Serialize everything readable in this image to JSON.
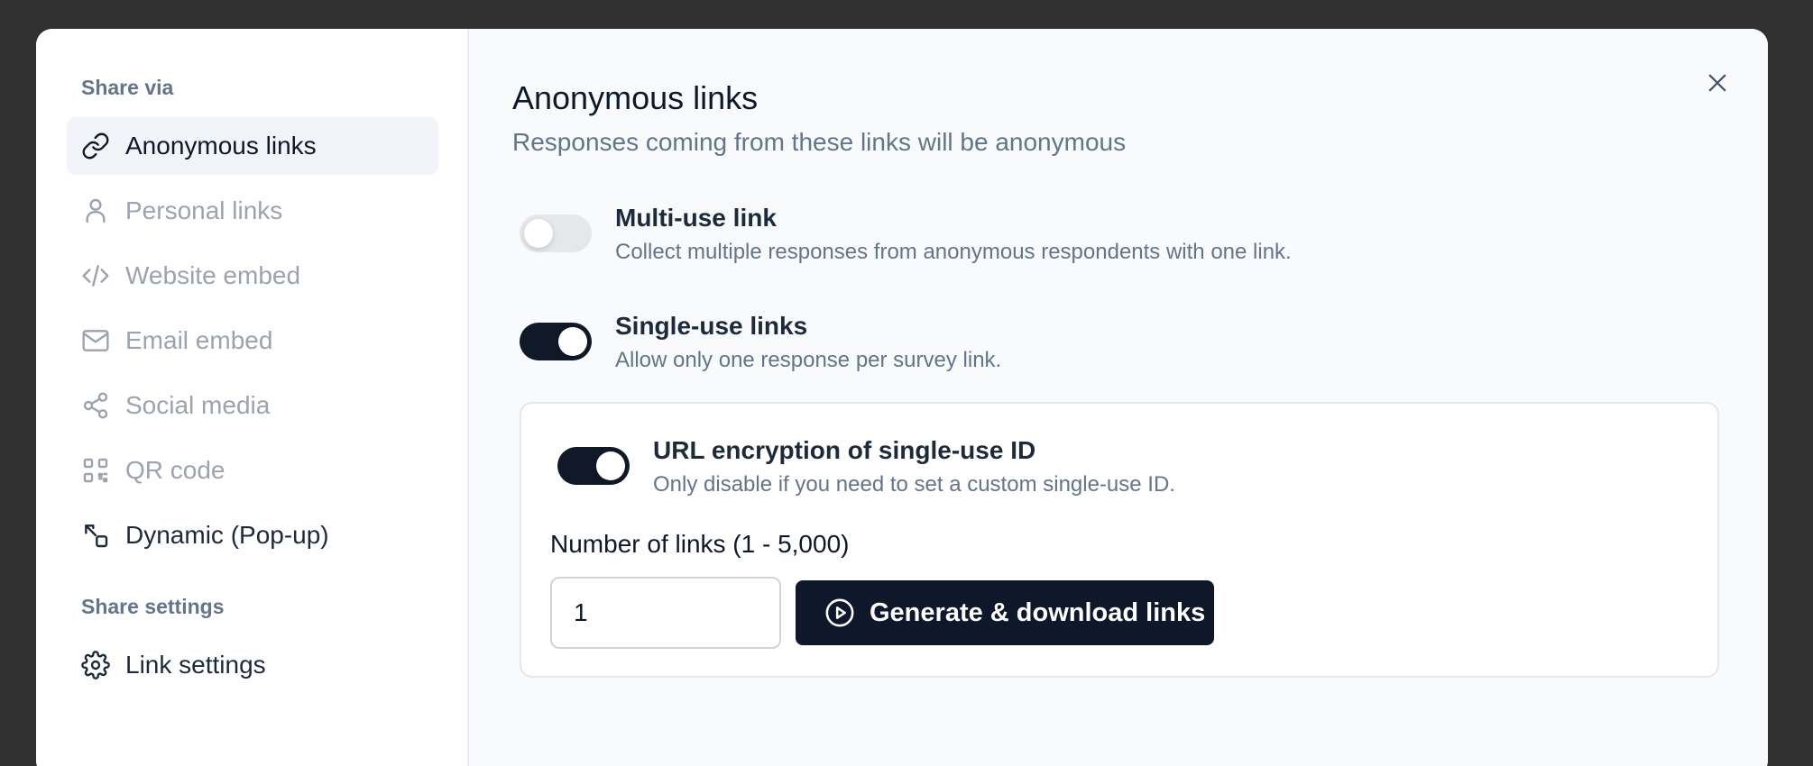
{
  "sidebar": {
    "share_via_label": "Share via",
    "share_settings_label": "Share settings",
    "items": [
      {
        "label": "Anonymous links",
        "icon": "link-icon"
      },
      {
        "label": "Personal links",
        "icon": "user-icon"
      },
      {
        "label": "Website embed",
        "icon": "code-icon"
      },
      {
        "label": "Email embed",
        "icon": "mail-icon"
      },
      {
        "label": "Social media",
        "icon": "share-icon"
      },
      {
        "label": "QR code",
        "icon": "qr-code-icon"
      },
      {
        "label": "Dynamic (Pop-up)",
        "icon": "squares-icon"
      }
    ],
    "settings_items": [
      {
        "label": "Link settings",
        "icon": "gear-icon"
      }
    ]
  },
  "main": {
    "title": "Anonymous links",
    "subtitle": "Responses coming from these links will be anonymous",
    "options": [
      {
        "title": "Multi-use link",
        "description": "Collect multiple responses from anonymous respondents with one link.",
        "enabled": false
      },
      {
        "title": "Single-use links",
        "description": "Allow only one response per survey link.",
        "enabled": true
      }
    ],
    "encryption": {
      "title": "URL encryption of single-use ID",
      "description": "Only disable if you need to set a custom single-use ID.",
      "enabled": true
    },
    "number_of_links": {
      "label": "Number of links (1 - 5,000)",
      "value": "1"
    },
    "generate_button_label": "Generate & download links"
  },
  "colors": {
    "accent": "#0f172a",
    "background": "#f8fafc",
    "muted": "#64748b"
  }
}
